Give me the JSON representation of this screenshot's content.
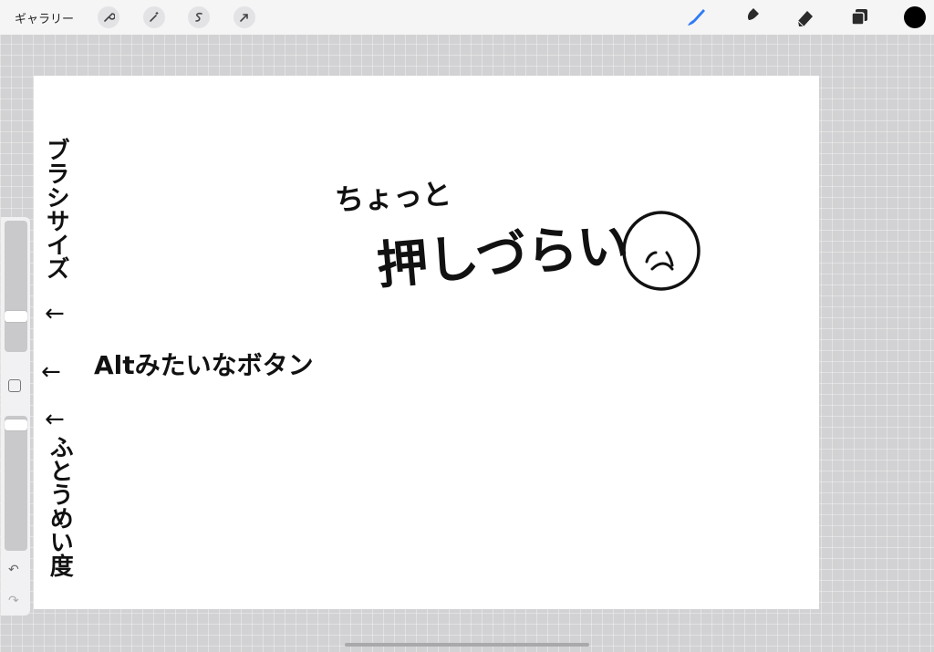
{
  "topbar": {
    "gallery_label": "ギャラリー",
    "left_tools": [
      "wrench-icon",
      "magic-wand-icon",
      "selection-icon",
      "transform-arrow-icon"
    ],
    "right_tools": [
      "brush-icon",
      "smudge-icon",
      "eraser-icon",
      "layers-icon"
    ],
    "active_tool": "brush-icon",
    "accent_color": "#2f7bf5",
    "current_color": "#000000"
  },
  "sidebar": {
    "brush_size_level": 0.25,
    "opacity_level": 0.9,
    "undo_icon": "undo-icon",
    "redo_icon": "redo-icon"
  },
  "canvas": {
    "note_top": "ちょっと",
    "note_main": "押しづらい",
    "label_brush_size": "ブラシサイズ",
    "label_alt": "Altみたいなボタン",
    "label_opacity": "ふとうめい度",
    "arrow": "←"
  }
}
